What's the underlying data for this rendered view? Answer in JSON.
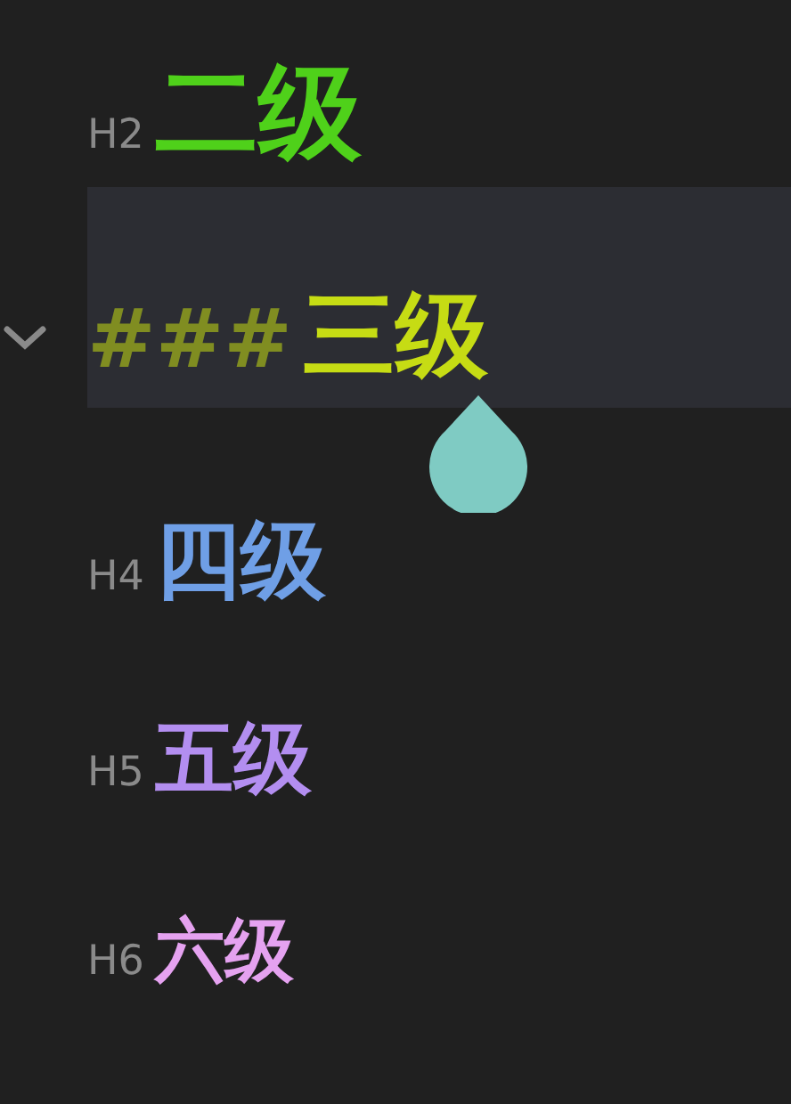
{
  "headings": [
    {
      "kind": "tag",
      "marker": "H2",
      "text": "二级",
      "color": "#4fd11a",
      "selected": false
    },
    {
      "kind": "source",
      "marker": "###",
      "text": "三级",
      "color": "#c6dc14",
      "selected": true
    },
    {
      "kind": "tag",
      "marker": "H4",
      "text": "四级",
      "color": "#6f9fe6",
      "selected": false
    },
    {
      "kind": "tag",
      "marker": "H5",
      "text": "五级",
      "color": "#b38ef0",
      "selected": false
    },
    {
      "kind": "tag",
      "marker": "H6",
      "text": "六级",
      "color": "#e5a2f0",
      "selected": false
    }
  ]
}
